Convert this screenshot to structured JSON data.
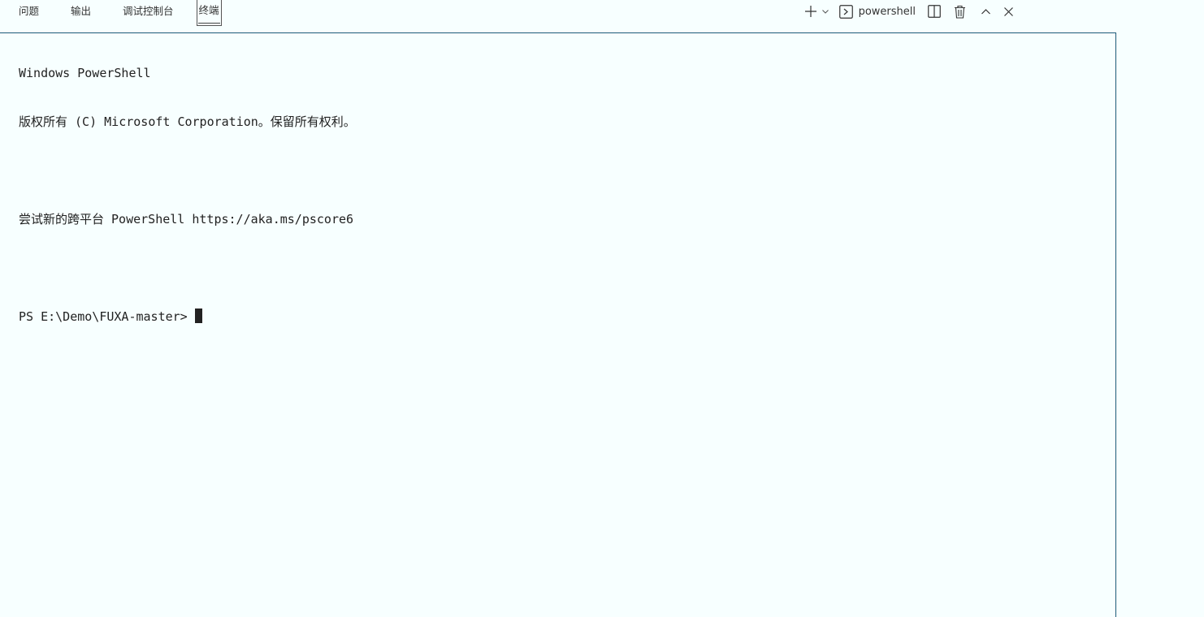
{
  "panel": {
    "tabs": [
      {
        "label": "问题"
      },
      {
        "label": "输出"
      },
      {
        "label": "调试控制台"
      },
      {
        "label": "终端"
      }
    ],
    "active_tab": "终端",
    "shell_name": "powershell"
  },
  "terminal": {
    "lines": [
      "Windows PowerShell",
      "版权所有 (C) Microsoft Corporation。保留所有权利。",
      "",
      "尝试新的跨平台 PowerShell https://aka.ms/pscore6",
      ""
    ],
    "prompt": "PS E:\\Demo\\FUXA-master>"
  },
  "icons": {
    "new_terminal": "plus-icon",
    "dropdown": "chevron-down-icon",
    "shell": "terminal-icon",
    "split": "split-icon",
    "kill": "trash-icon",
    "maximize": "chevron-up-icon",
    "close": "close-icon"
  }
}
